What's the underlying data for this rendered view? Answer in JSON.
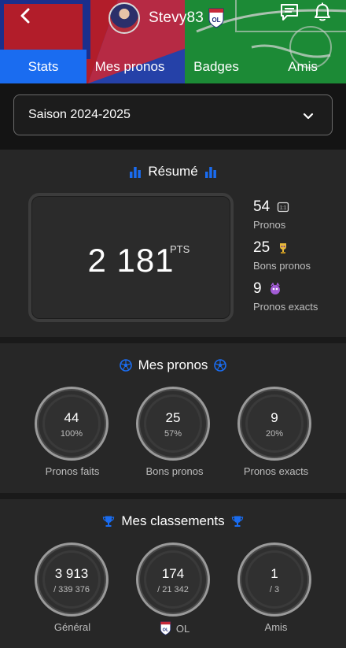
{
  "header": {
    "username": "Stevy83",
    "tabs": [
      {
        "label": "Stats",
        "active": true
      },
      {
        "label": "Mes pronos",
        "active": false
      },
      {
        "label": "Badges",
        "active": false
      },
      {
        "label": "Amis",
        "active": false
      }
    ],
    "icons": {
      "back": "chevron-left-icon",
      "messages": "chat-icon",
      "notifications": "bell-icon"
    }
  },
  "season": {
    "selected": "Saison 2024-2025"
  },
  "resume": {
    "title": "Résumé",
    "points_value": "2 181",
    "points_unit": "PTS",
    "stats": [
      {
        "value": "54",
        "label": "Pronos",
        "icon": "score-icon"
      },
      {
        "value": "25",
        "label": "Bons pronos",
        "icon": "trophy-icon"
      },
      {
        "value": "9",
        "label": "Pronos exacts",
        "icon": "purple-creature-icon"
      }
    ]
  },
  "mes_pronos": {
    "title": "Mes pronos",
    "items": [
      {
        "value": "44",
        "sub": "100%",
        "label": "Pronos faits"
      },
      {
        "value": "25",
        "sub": "57%",
        "label": "Bons pronos"
      },
      {
        "value": "9",
        "sub": "20%",
        "label": "Pronos exacts"
      }
    ]
  },
  "classements": {
    "title": "Mes classements",
    "items": [
      {
        "value": "3 913",
        "sub": "/ 339 376",
        "label": "Général"
      },
      {
        "value": "174",
        "sub": "/ 21 342",
        "label": "OL"
      },
      {
        "value": "1",
        "sub": "/ 3",
        "label": "Amis"
      }
    ]
  },
  "colors": {
    "accent": "#1a6cf0",
    "background": "#1a1a1a",
    "section": "#272727"
  }
}
